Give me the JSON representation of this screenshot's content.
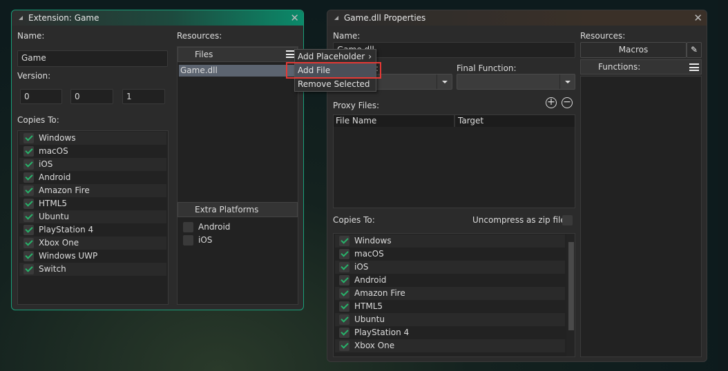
{
  "extension_window": {
    "title": "Extension: Game",
    "name_label": "Name:",
    "name_value": "Game",
    "version_label": "Version:",
    "version": [
      "0",
      "0",
      "1"
    ],
    "copies_label": "Copies To:",
    "copies": [
      {
        "label": "Windows",
        "checked": true
      },
      {
        "label": "macOS",
        "checked": true
      },
      {
        "label": "iOS",
        "checked": true
      },
      {
        "label": "Android",
        "checked": true
      },
      {
        "label": "Amazon Fire",
        "checked": true
      },
      {
        "label": "HTML5",
        "checked": true
      },
      {
        "label": "Ubuntu",
        "checked": true
      },
      {
        "label": "PlayStation 4",
        "checked": true
      },
      {
        "label": "Xbox One",
        "checked": true
      },
      {
        "label": "Windows UWP",
        "checked": true
      },
      {
        "label": "Switch",
        "checked": true
      }
    ],
    "resources_label": "Resources:",
    "files_header": "Files",
    "files": [
      "Game.dll"
    ],
    "extra_platforms_header": "Extra Platforms",
    "extra_platforms": [
      {
        "label": "Android",
        "checked": false
      },
      {
        "label": "iOS",
        "checked": false
      }
    ]
  },
  "context_menu": {
    "items": [
      "Add Placeholder",
      "Add File",
      "Remove Selected"
    ],
    "highlighted": "Add File",
    "highlight_color": "#e53935"
  },
  "properties_window": {
    "title": "Game.dll Properties",
    "name_label": "Name:",
    "name_value": "Game.dll",
    "init_label": ":",
    "final_label": "Final Function:",
    "proxy_label": "Proxy Files:",
    "proxy_columns": [
      "File Name",
      "Target"
    ],
    "copies_label": "Copies To:",
    "uncompress_label": "Uncompress as zip file",
    "copies": [
      {
        "label": "Windows",
        "checked": true
      },
      {
        "label": "macOS",
        "checked": true
      },
      {
        "label": "iOS",
        "checked": true
      },
      {
        "label": "Android",
        "checked": true
      },
      {
        "label": "Amazon Fire",
        "checked": true
      },
      {
        "label": "HTML5",
        "checked": true
      },
      {
        "label": "Ubuntu",
        "checked": true
      },
      {
        "label": "PlayStation 4",
        "checked": true
      },
      {
        "label": "Xbox One",
        "checked": true
      }
    ],
    "resources_label": "Resources:",
    "macros_label": "Macros",
    "functions_label": "Functions:"
  },
  "colors": {
    "accent": "#0b8a6a",
    "check": "#27b36a"
  }
}
